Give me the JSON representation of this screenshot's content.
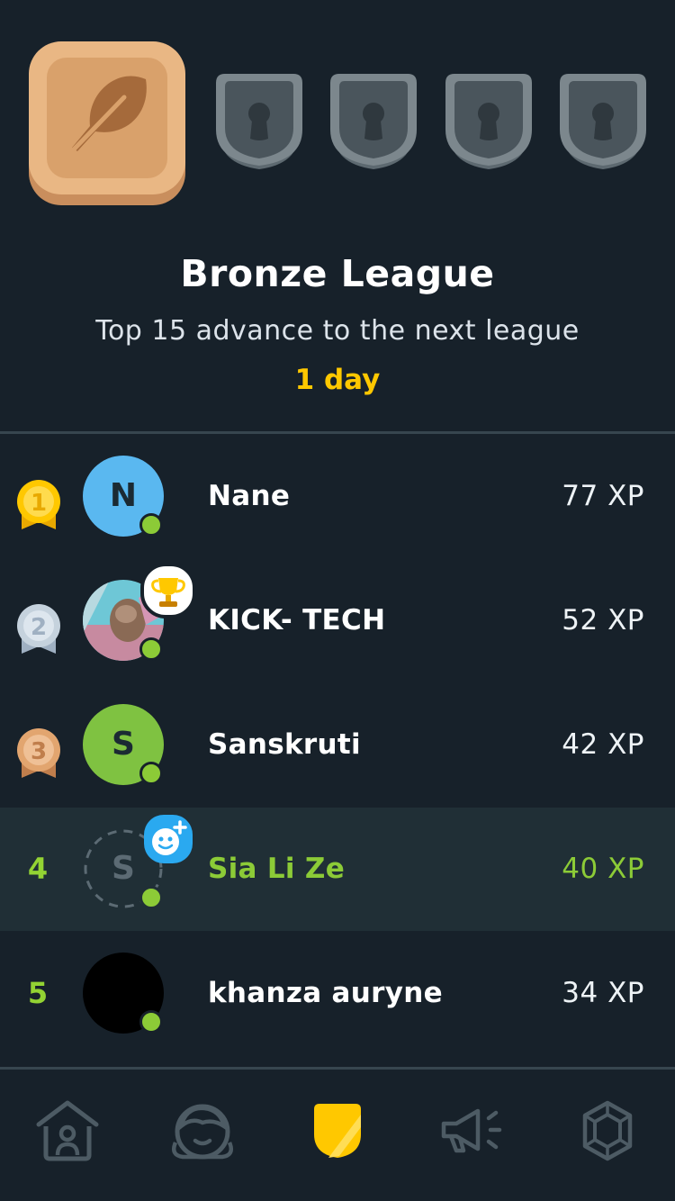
{
  "league": {
    "title": "Bronze League",
    "subtitle": "Top 15 advance to the next league",
    "time_left": "1 day",
    "current_badge": "bronze-feather-icon",
    "locked_badges": [
      "locked-league-icon",
      "locked-league-icon",
      "locked-league-icon",
      "locked-league-icon"
    ]
  },
  "leaderboard": [
    {
      "rank": "1",
      "medal": "gold-medal-icon",
      "initial": "N",
      "name": "Nane",
      "xp": "77 XP",
      "avatar_color": "#5ab8f0",
      "online": true
    },
    {
      "rank": "2",
      "medal": "silver-medal-icon",
      "initial": "",
      "name": "KICK- TECH",
      "xp": "52 XP",
      "avatar_color": "#6ec7d6",
      "online": true,
      "badge": "trophy-icon"
    },
    {
      "rank": "3",
      "medal": "bronze-medal-icon",
      "initial": "S",
      "name": "Sanskruti",
      "xp": "42 XP",
      "avatar_color": "#7fc241",
      "online": true
    },
    {
      "rank": "4",
      "initial": "S",
      "name": "Sia Li Ze",
      "xp": "40 XP",
      "online": true,
      "current_user": true,
      "badge": "add-friend-icon"
    },
    {
      "rank": "5",
      "initial": "",
      "name": "khanza auryne",
      "xp": "34 XP",
      "avatar_color": "#000000",
      "online": true
    }
  ],
  "tabs": [
    {
      "name": "home-icon"
    },
    {
      "name": "profile-icon"
    },
    {
      "name": "leagues-icon",
      "active": true
    },
    {
      "name": "news-icon"
    },
    {
      "name": "shop-icon"
    }
  ],
  "colors": {
    "background": "#17212a",
    "accent_green": "#8ccb37",
    "gold_text": "#ffc800",
    "current_row": "#202f36"
  }
}
